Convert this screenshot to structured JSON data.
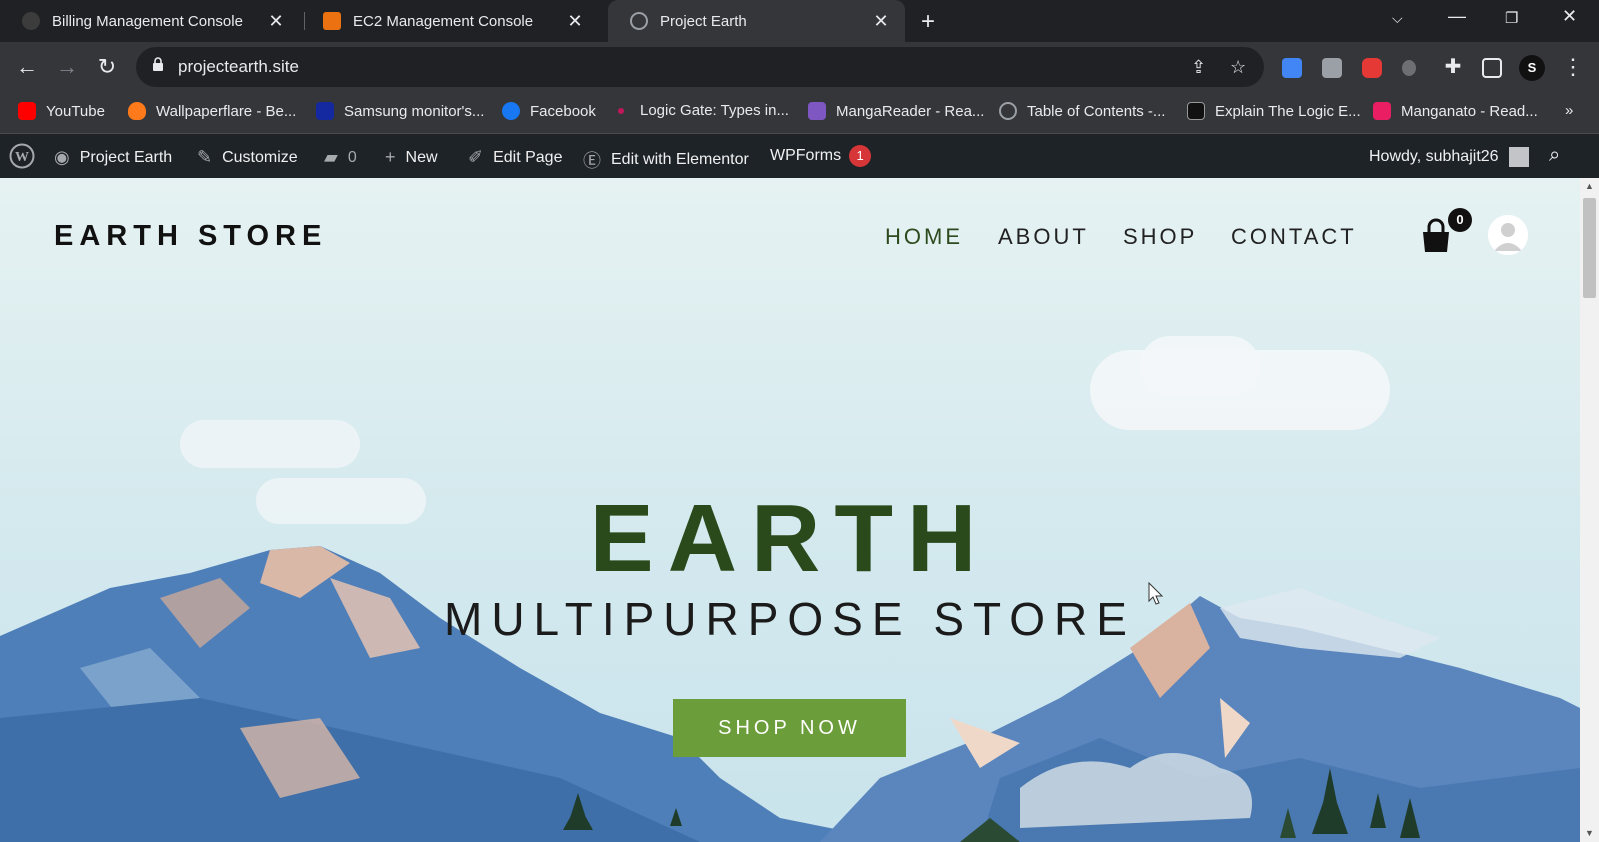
{
  "tabs": [
    {
      "title": "Billing Management Console"
    },
    {
      "title": "EC2 Management Console"
    },
    {
      "title": "Project Earth"
    }
  ],
  "address": {
    "url": "projectearth.site"
  },
  "bookmarks": [
    {
      "label": "YouTube"
    },
    {
      "label": "Wallpaperflare - Be..."
    },
    {
      "label": "Samsung monitor's..."
    },
    {
      "label": "Facebook"
    },
    {
      "label": "Logic Gate: Types in..."
    },
    {
      "label": "MangaReader - Rea..."
    },
    {
      "label": "Table of Contents -..."
    },
    {
      "label": "Explain The Logic E..."
    },
    {
      "label": "Manganato - Read..."
    }
  ],
  "profile_initial": "S",
  "wp_admin": {
    "site_name": "Project Earth",
    "customize": "Customize",
    "comments": "0",
    "new": "New",
    "edit_page": "Edit Page",
    "edit_elementor": "Edit with Elementor",
    "wpforms": "WPForms",
    "wpforms_count": "1",
    "howdy": "Howdy, subhajit26"
  },
  "site": {
    "logo": "EARTH STORE",
    "nav": [
      "HOME",
      "ABOUT",
      "SHOP",
      "CONTACT"
    ],
    "cart_count": "0",
    "hero_title": "EARTH",
    "hero_subtitle": "MULTIPURPOSE STORE",
    "cta": "SHOP NOW"
  },
  "colors": {
    "accent_green": "#6b9e3a",
    "title_green": "#2a4a1c",
    "wp_bar": "#1d2327"
  }
}
